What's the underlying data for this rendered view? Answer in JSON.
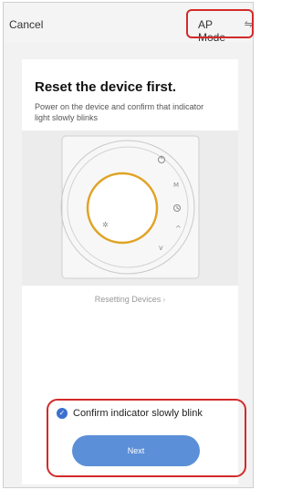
{
  "header": {
    "cancel_label": "Cancel",
    "ap_mode_label": "AP Mode",
    "ap_mode_icon": "swap-icon"
  },
  "content": {
    "title": "Reset the device first.",
    "subtitle": "Power on the device and confirm that indicator light slowly blinks",
    "resetting_link": "Resetting Devices",
    "resetting_chevron_icon": "chevron-right-icon"
  },
  "device_illustration": {
    "ring_color": "#e0a325",
    "button_icons": [
      "power-icon",
      "m-icon",
      "clock-icon",
      "up-arrow-icon",
      "down-arrow-icon",
      "snowflake-icon"
    ]
  },
  "footer": {
    "confirm_label": "Confirm indicator slowly blink",
    "confirm_checked": true,
    "next_label": "Next"
  },
  "colors": {
    "highlight": "#d32a2a",
    "primary_button": "#5b8fd8",
    "checkbox": "#3b6fcf"
  }
}
